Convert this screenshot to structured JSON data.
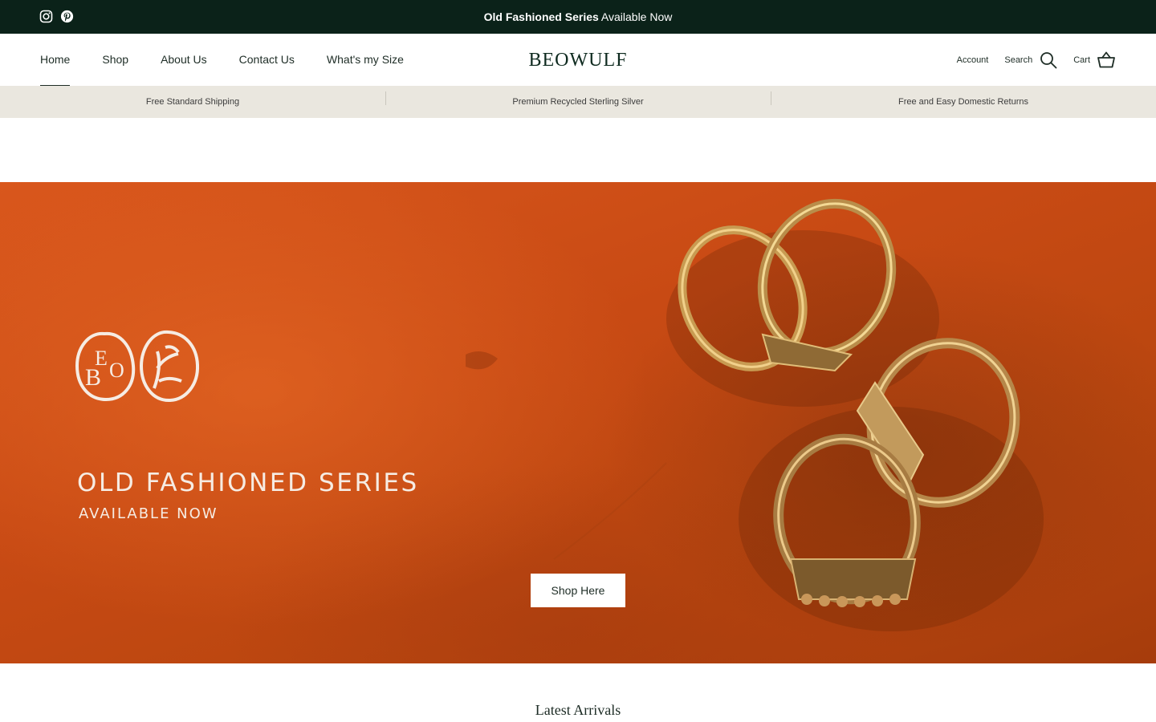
{
  "announcement": {
    "bold": "Old Fashioned Series",
    "rest": " Available Now"
  },
  "social": [
    "instagram-icon",
    "pinterest-icon"
  ],
  "nav": [
    {
      "label": "Home",
      "active": true
    },
    {
      "label": "Shop"
    },
    {
      "label": "About Us"
    },
    {
      "label": "Contact Us"
    },
    {
      "label": "What's my Size"
    }
  ],
  "brand": "BEOWULF",
  "tools": {
    "account": "Account",
    "search": "Search",
    "cart": "Cart"
  },
  "usp": [
    "Free Standard Shipping",
    "Premium Recycled Sterling Silver",
    "Free and Easy Domestic Returns"
  ],
  "hero": {
    "title": "OLD FASHIONED SERIES",
    "subtitle": "AVAILABLE NOW",
    "button": "Shop Here",
    "logo_letters": "BEO"
  },
  "section": {
    "title": "Latest Arrivals"
  },
  "colors": {
    "announce_bg": "#0b2219",
    "usp_bg": "#eae7df",
    "hero_orange": "#c84a14"
  }
}
